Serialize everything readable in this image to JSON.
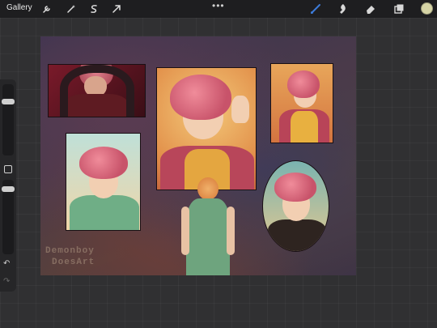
{
  "toolbar": {
    "gallery_label": "Gallery",
    "more_icon": "•••",
    "left_tools": [
      "wrench-icon",
      "magic-wand-icon",
      "selection-icon",
      "transform-arrow-icon"
    ],
    "right_tools": [
      "brush-icon",
      "smudge-icon",
      "eraser-icon",
      "layers-icon"
    ],
    "active_tool": "brush-icon",
    "accent_color": "#3d7bd9",
    "current_color": "#d6d4a6"
  },
  "sidebar": {
    "undo_label": "↶",
    "redo_label": "↷"
  },
  "canvas": {
    "watermark_line1": "Demonboy",
    "watermark_line2": "DoesArt"
  }
}
